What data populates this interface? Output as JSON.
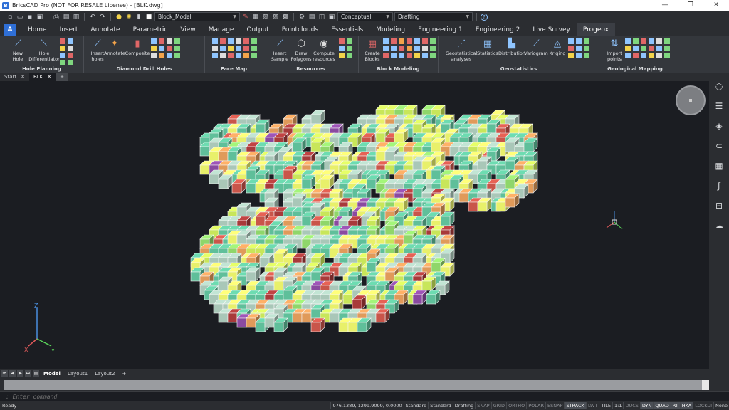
{
  "title_bar": {
    "title": "BricsCAD Pro (NOT FOR RESALE License) - [BLK.dwg]",
    "minimize": "—",
    "maximize": "❐",
    "close": "✕"
  },
  "quick_access": {
    "layer_combo": "Block_Model",
    "visual_style_combo": "Conceptual",
    "workspace_combo": "Drafting",
    "help": "?"
  },
  "ribbon_tabs": [
    "Home",
    "Insert",
    "Annotate",
    "Parametric",
    "View",
    "Manage",
    "Output",
    "Pointclouds",
    "Essentials",
    "Modeling",
    "Engineering 1",
    "Engineering 2",
    "Live Survey",
    "Progeox"
  ],
  "active_tab": "Progeox",
  "logo": "A",
  "panels": [
    {
      "title": "Hole Planning",
      "buttons": [
        "New\nHole",
        "Hole\nDifferentiator"
      ]
    },
    {
      "title": "Diamond Drill Holes",
      "buttons": [
        "Insert\nholes",
        "Annotate",
        "Composite"
      ]
    },
    {
      "title": "Face Map",
      "buttons": []
    },
    {
      "title": "Resources",
      "buttons": [
        "Insert\nSample",
        "Draw\nPolygons",
        "Compute\nresources"
      ]
    },
    {
      "title": "Block Modeling",
      "buttons": [
        "Create\nBlocks"
      ]
    },
    {
      "title": "Geostatistics",
      "buttons": [
        "Geostatistical\nanalyses",
        "Statistics",
        "Distribution",
        "Variogram",
        "Kriging"
      ]
    },
    {
      "title": "Geological Mapping",
      "buttons": [
        "Import\npoints"
      ]
    }
  ],
  "doc_tabs": [
    {
      "label": "Start",
      "close": "✕"
    },
    {
      "label": "BLK",
      "close": "✕"
    }
  ],
  "new_tab": "+",
  "axis": {
    "z": "Z",
    "x": "X",
    "y": "Y"
  },
  "layout_tabs": [
    "Model",
    "Layout1",
    "Layout2"
  ],
  "layout_add": "+",
  "command": {
    "placeholder": ": Enter command"
  },
  "status": {
    "ready": "Ready",
    "coords": "976.1389, 1299.9099, 0.0000",
    "items": [
      {
        "label": "Standard",
        "on": false,
        "txt": true
      },
      {
        "label": "Standard",
        "on": false,
        "txt": true
      },
      {
        "label": "Drafting",
        "on": false,
        "txt": true
      },
      {
        "label": "SNAP",
        "on": false
      },
      {
        "label": "GRID",
        "on": false
      },
      {
        "label": "ORTHO",
        "on": false
      },
      {
        "label": "POLAR",
        "on": false
      },
      {
        "label": "ESNAP",
        "on": false
      },
      {
        "label": "STRACK",
        "on": true
      },
      {
        "label": "LWT",
        "on": false
      },
      {
        "label": "TILE",
        "on": false,
        "txt": true
      },
      {
        "label": "1:1",
        "on": false,
        "txt": true
      },
      {
        "label": "DUCS",
        "on": false
      },
      {
        "label": "DYN",
        "on": true
      },
      {
        "label": "QUAD",
        "on": true
      },
      {
        "label": "RT",
        "on": true
      },
      {
        "label": "HKA",
        "on": true
      },
      {
        "label": "LOCKUI",
        "on": false
      },
      {
        "label": "None",
        "on": false,
        "txt": true
      }
    ]
  },
  "colors": {
    "accent": "#2f6fd6",
    "background": "#1b1d22"
  }
}
